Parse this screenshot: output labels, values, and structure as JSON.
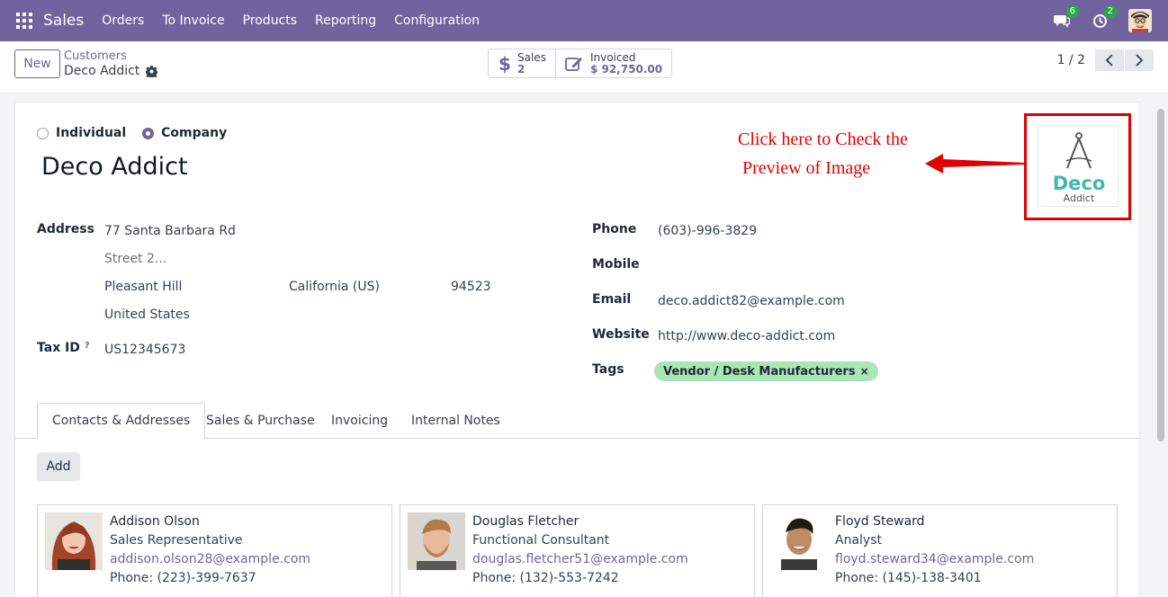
{
  "navbar": {
    "app": "Sales",
    "menu": [
      "Orders",
      "To Invoice",
      "Products",
      "Reporting",
      "Configuration"
    ],
    "messages_count": "6",
    "activities_count": "2"
  },
  "control": {
    "new_label": "New",
    "breadcrumb_parent": "Customers",
    "breadcrumb_current": "Deco Addict",
    "smart_buttons": [
      {
        "label": "Sales",
        "value": "2"
      },
      {
        "label": "Invoiced",
        "value": "$ 92,750.00"
      }
    ],
    "pager": "1 / 2"
  },
  "form": {
    "radio_individual": "Individual",
    "radio_company": "Company",
    "name": "Deco Addict",
    "address_label": "Address",
    "street": "77 Santa Barbara Rd",
    "street2_placeholder": "Street 2...",
    "city": "Pleasant Hill",
    "state": "California (US)",
    "zip": "94523",
    "country": "United States",
    "taxid_label": "Tax ID",
    "taxid_tip": "?",
    "taxid": "US12345673",
    "phone_label": "Phone",
    "phone": "(603)-996-3829",
    "mobile_label": "Mobile",
    "email_label": "Email",
    "email": "deco.addict82@example.com",
    "website_label": "Website",
    "website": "http://www.deco-addict.com",
    "tags_label": "Tags",
    "tag": "Vendor / Desk Manufacturers",
    "tag_remove": "×",
    "logo_text_1": "Deco",
    "logo_text_2": "Addict"
  },
  "annotation": {
    "line1": "Click here to Check the",
    "line2": "Preview of Image",
    "color": "#e00000"
  },
  "tabs": [
    "Contacts & Addresses",
    "Sales & Purchase",
    "Invoicing",
    "Internal Notes"
  ],
  "add_label": "Add",
  "contacts": [
    {
      "name": "Addison Olson",
      "function": "Sales Representative",
      "email": "addison.olson28@example.com",
      "phone": "Phone: (223)-399-7637"
    },
    {
      "name": "Douglas Fletcher",
      "function": "Functional Consultant",
      "email": "douglas.fletcher51@example.com",
      "phone": "Phone: (132)-553-7242"
    },
    {
      "name": "Floyd Steward",
      "function": "Analyst",
      "email": "floyd.steward34@example.com",
      "phone": "Phone: (145)-138-3401"
    }
  ],
  "colors": {
    "brand": "#71639e",
    "tag": "#a8e6b5",
    "highlight": "#e00000"
  }
}
